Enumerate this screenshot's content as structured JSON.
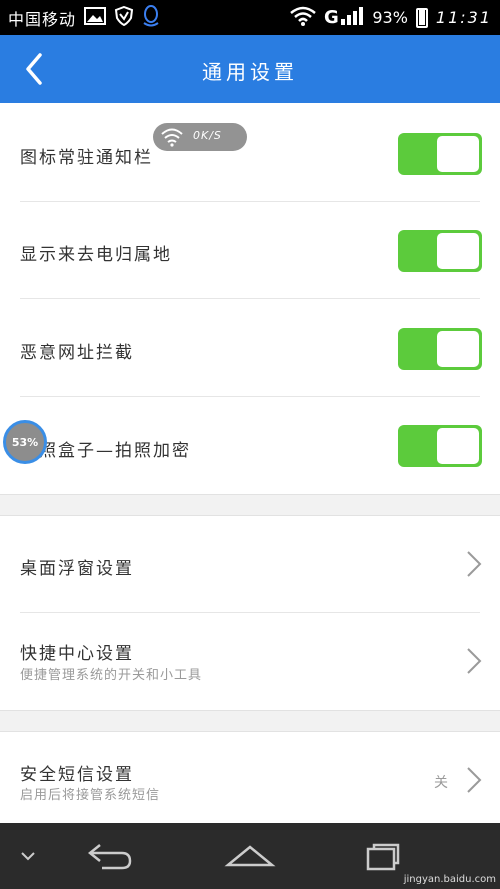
{
  "status_bar": {
    "carrier": "中国移动",
    "signal_text": "G",
    "battery_percent": "93%",
    "time": "11:31"
  },
  "nav": {
    "title": "通用设置"
  },
  "speed_indicator": {
    "text": "0K/S"
  },
  "float_ball": {
    "percent": "53%"
  },
  "settings_group_1": [
    {
      "label": "图标常驻通知栏",
      "enabled": true
    },
    {
      "label": "显示来去电归属地",
      "enabled": true
    },
    {
      "label": "恶意网址拦截",
      "enabled": true
    },
    {
      "label": "拍照盒子—拍照加密",
      "enabled": true
    }
  ],
  "settings_group_2": [
    {
      "label": "桌面浮窗设置",
      "sub": ""
    },
    {
      "label": "快捷中心设置",
      "sub": "便捷管理系统的开关和小工具"
    }
  ],
  "settings_group_3": [
    {
      "label": "安全短信设置",
      "sub": "启用后将接管系统短信",
      "value": "关"
    }
  ],
  "watermark": {
    "text": "jingyan.baidu.com"
  },
  "colors": {
    "primary": "#2a7de1",
    "toggle_on": "#5ccb3c",
    "status_bar": "#000000",
    "bottom_nav": "#2b2b2b"
  }
}
